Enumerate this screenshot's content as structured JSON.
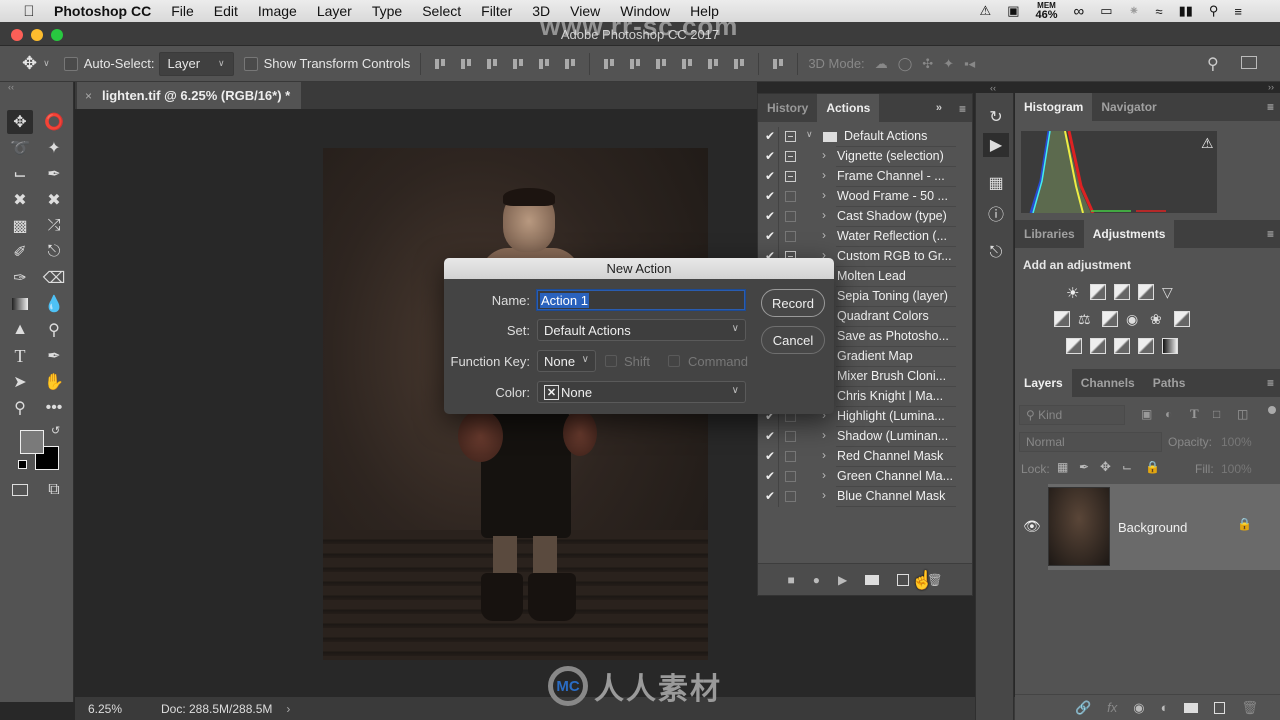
{
  "menubar": {
    "apple_icon": "apple-icon",
    "items": [
      "Photoshop CC",
      "File",
      "Edit",
      "Image",
      "Layer",
      "Type",
      "Select",
      "Filter",
      "3D",
      "View",
      "Window",
      "Help"
    ],
    "status": {
      "mem_label": "MEM",
      "mem_value": "46%"
    }
  },
  "window": {
    "title": "Adobe Photoshop CC 2017"
  },
  "watermark": {
    "url": "www.rr-sc.com",
    "brand": "人人素材",
    "logo": "MC"
  },
  "options_bar": {
    "auto_select_label": "Auto-Select:",
    "auto_select_value": "Layer",
    "show_transform_label": "Show Transform Controls",
    "mode_3d_label": "3D Mode:"
  },
  "document": {
    "tab_title": "lighten.tif @ 6.25% (RGB/16*) *",
    "close_glyph": "×"
  },
  "status_bar": {
    "zoom": "6.25%",
    "doc_info": "Doc: 288.5M/288.5M",
    "arrow": "›"
  },
  "actions_panel": {
    "tabs": [
      "History",
      "Actions"
    ],
    "active_tab": "Actions",
    "set_name": "Default Actions",
    "items": [
      {
        "label": "Vignette (selection)",
        "checked": true,
        "dialog": true
      },
      {
        "label": "Frame Channel - ...",
        "checked": true,
        "dialog": true
      },
      {
        "label": "Wood Frame - 50 ...",
        "checked": true,
        "dialog": false
      },
      {
        "label": "Cast Shadow (type)",
        "checked": true,
        "dialog": false
      },
      {
        "label": "Water Reflection (...",
        "checked": true,
        "dialog": false
      },
      {
        "label": "Custom RGB to Gr...",
        "checked": true,
        "dialog": true
      },
      {
        "label": "Molten Lead",
        "checked": true,
        "dialog": false
      },
      {
        "label": "Sepia Toning (layer)",
        "checked": true,
        "dialog": false
      },
      {
        "label": "Quadrant Colors",
        "checked": true,
        "dialog": false
      },
      {
        "label": "Save as Photosho...",
        "checked": true,
        "dialog": false
      },
      {
        "label": "Gradient Map",
        "checked": true,
        "dialog": false
      },
      {
        "label": "Mixer Brush Cloni...",
        "checked": true,
        "dialog": false
      },
      {
        "label": "Chris Knight | Ma...",
        "checked": true,
        "dialog": false
      },
      {
        "label": "Highlight (Lumina...",
        "checked": true,
        "dialog": false
      },
      {
        "label": "Shadow (Luminan...",
        "checked": true,
        "dialog": false
      },
      {
        "label": "Red Channel Mask",
        "checked": true,
        "dialog": false
      },
      {
        "label": "Green Channel Ma...",
        "checked": true,
        "dialog": false
      },
      {
        "label": "Blue Channel Mask",
        "checked": true,
        "dialog": false
      }
    ]
  },
  "new_action_dialog": {
    "title": "New Action",
    "name_label": "Name:",
    "name_value": "Action 1",
    "set_label": "Set:",
    "set_value": "Default Actions",
    "function_key_label": "Function Key:",
    "function_key_value": "None",
    "shift_label": "Shift",
    "command_label": "Command",
    "color_label": "Color:",
    "color_value": "None",
    "record_button": "Record",
    "cancel_button": "Cancel"
  },
  "histogram_panel": {
    "tabs": [
      "Histogram",
      "Navigator"
    ],
    "active_tab": "Histogram",
    "warning_icon": "⚠"
  },
  "adjustments_panel": {
    "tabs": [
      "Libraries",
      "Adjustments"
    ],
    "active_tab": "Adjustments",
    "heading": "Add an adjustment"
  },
  "layers_panel": {
    "tabs": [
      "Layers",
      "Channels",
      "Paths"
    ],
    "active_tab": "Layers",
    "filter_placeholder": "Kind",
    "blend_mode": "Normal",
    "opacity_label": "Opacity:",
    "opacity_value": "100%",
    "lock_label": "Lock:",
    "fill_label": "Fill:",
    "fill_value": "100%",
    "layers": [
      {
        "name": "Background",
        "visible": true,
        "locked": true
      }
    ]
  },
  "colors": {
    "accent": "#2a62bd",
    "panel_bg": "#535353",
    "dark_bg": "#282828"
  }
}
